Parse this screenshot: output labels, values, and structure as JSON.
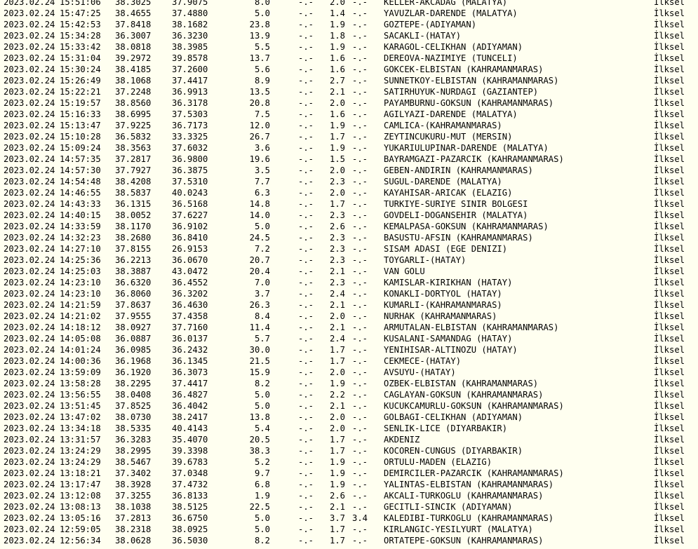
{
  "events": [
    {
      "date": "2023.02.24",
      "time": "15:51:06",
      "lat": "38.3025",
      "lon": "37.9075",
      "depth": "8.0",
      "md": "-.-",
      "ml": "2.0",
      "mw": "-.-",
      "place": "KELLER-AKCADAG (MALATYA)",
      "type": "İlksel"
    },
    {
      "date": "2023.02.24",
      "time": "15:47:25",
      "lat": "38.4655",
      "lon": "37.4880",
      "depth": "5.0",
      "md": "-.-",
      "ml": "1.4",
      "mw": "-.-",
      "place": "YAVUZLAR-DARENDE (MALATYA)",
      "type": "İlksel"
    },
    {
      "date": "2023.02.24",
      "time": "15:42:53",
      "lat": "37.8418",
      "lon": "38.1682",
      "depth": "23.8",
      "md": "-.-",
      "ml": "1.9",
      "mw": "-.-",
      "place": "GOZTEPE-(ADIYAMAN)",
      "type": "İlksel"
    },
    {
      "date": "2023.02.24",
      "time": "15:34:28",
      "lat": "36.3007",
      "lon": "36.3230",
      "depth": "13.9",
      "md": "-.-",
      "ml": "1.8",
      "mw": "-.-",
      "place": "SACAKLI-(HATAY)",
      "type": "İlksel"
    },
    {
      "date": "2023.02.24",
      "time": "15:33:42",
      "lat": "38.0818",
      "lon": "38.3985",
      "depth": "5.5",
      "md": "-.-",
      "ml": "1.9",
      "mw": "-.-",
      "place": "KARAGOL-CELIKHAN (ADIYAMAN)",
      "type": "İlksel"
    },
    {
      "date": "2023.02.24",
      "time": "15:31:04",
      "lat": "39.2972",
      "lon": "39.8578",
      "depth": "13.7",
      "md": "-.-",
      "ml": "1.6",
      "mw": "-.-",
      "place": "DEREOVA-NAZIMIYE (TUNCELI)",
      "type": "İlksel"
    },
    {
      "date": "2023.02.24",
      "time": "15:30:24",
      "lat": "38.4185",
      "lon": "37.2600",
      "depth": "5.6",
      "md": "-.-",
      "ml": "1.6",
      "mw": "-.-",
      "place": "GOKCEK-ELBISTAN (KAHRAMANMARAS)",
      "type": "İlksel"
    },
    {
      "date": "2023.02.24",
      "time": "15:26:49",
      "lat": "38.1068",
      "lon": "37.4417",
      "depth": "8.9",
      "md": "-.-",
      "ml": "2.7",
      "mw": "-.-",
      "place": "SUNNETKOY-ELBISTAN (KAHRAMANMARAS)",
      "type": "İlksel"
    },
    {
      "date": "2023.02.24",
      "time": "15:22:21",
      "lat": "37.2248",
      "lon": "36.9913",
      "depth": "13.5",
      "md": "-.-",
      "ml": "2.1",
      "mw": "-.-",
      "place": "SATIRHUYUK-NURDAGI (GAZIANTEP)",
      "type": "İlksel"
    },
    {
      "date": "2023.02.24",
      "time": "15:19:57",
      "lat": "38.8560",
      "lon": "36.3178",
      "depth": "20.8",
      "md": "-.-",
      "ml": "2.0",
      "mw": "-.-",
      "place": "PAYAMBURNU-GOKSUN (KAHRAMANMARAS)",
      "type": "İlksel"
    },
    {
      "date": "2023.02.24",
      "time": "15:16:33",
      "lat": "38.6995",
      "lon": "37.5303",
      "depth": "7.5",
      "md": "-.-",
      "ml": "1.6",
      "mw": "-.-",
      "place": "AGILYAZI-DARENDE (MALATYA)",
      "type": "İlksel"
    },
    {
      "date": "2023.02.24",
      "time": "15:13:47",
      "lat": "37.9225",
      "lon": "36.7173",
      "depth": "12.0",
      "md": "-.-",
      "ml": "1.9",
      "mw": "-.-",
      "place": "CAMLICA-(KAHRAMANMARAS)",
      "type": "İlksel"
    },
    {
      "date": "2023.02.24",
      "time": "15:10:28",
      "lat": "36.5832",
      "lon": "33.3325",
      "depth": "26.7",
      "md": "-.-",
      "ml": "1.7",
      "mw": "-.-",
      "place": "ZEYTINCUKURU-MUT (MERSIN)",
      "type": "İlksel"
    },
    {
      "date": "2023.02.24",
      "time": "15:09:24",
      "lat": "38.3563",
      "lon": "37.6032",
      "depth": "3.6",
      "md": "-.-",
      "ml": "1.9",
      "mw": "-.-",
      "place": "YUKARIULUPINAR-DARENDE (MALATYA)",
      "type": "İlksel"
    },
    {
      "date": "2023.02.24",
      "time": "14:57:35",
      "lat": "37.2817",
      "lon": "36.9800",
      "depth": "19.6",
      "md": "-.-",
      "ml": "1.5",
      "mw": "-.-",
      "place": "BAYRAMGAZI-PAZARCIK (KAHRAMANMARAS)",
      "type": "İlksel"
    },
    {
      "date": "2023.02.24",
      "time": "14:57:30",
      "lat": "37.7927",
      "lon": "36.3875",
      "depth": "3.5",
      "md": "-.-",
      "ml": "2.0",
      "mw": "-.-",
      "place": "GEBEN-ANDIRIN (KAHRAMANMARAS)",
      "type": "İlksel"
    },
    {
      "date": "2023.02.24",
      "time": "14:54:48",
      "lat": "38.4208",
      "lon": "37.5310",
      "depth": "7.7",
      "md": "-.-",
      "ml": "2.3",
      "mw": "-.-",
      "place": "SUGUL-DARENDE (MALATYA)",
      "type": "İlksel"
    },
    {
      "date": "2023.02.24",
      "time": "14:46:55",
      "lat": "38.5837",
      "lon": "40.0243",
      "depth": "6.3",
      "md": "-.-",
      "ml": "2.0",
      "mw": "-.-",
      "place": "KAYAHISAR-ARICAK (ELAZIG)",
      "type": "İlksel"
    },
    {
      "date": "2023.02.24",
      "time": "14:43:33",
      "lat": "36.1315",
      "lon": "36.5168",
      "depth": "14.8",
      "md": "-.-",
      "ml": "1.7",
      "mw": "-.-",
      "place": "TURKIYE-SURIYE SINIR BOLGESI",
      "type": "İlksel"
    },
    {
      "date": "2023.02.24",
      "time": "14:40:15",
      "lat": "38.0052",
      "lon": "37.6227",
      "depth": "14.0",
      "md": "-.-",
      "ml": "2.3",
      "mw": "-.-",
      "place": "GOVDELI-DOGANSEHIR (MALATYA)",
      "type": "İlksel"
    },
    {
      "date": "2023.02.24",
      "time": "14:33:59",
      "lat": "38.1170",
      "lon": "36.9102",
      "depth": "5.0",
      "md": "-.-",
      "ml": "2.6",
      "mw": "-.-",
      "place": "KEMALPASA-GOKSUN (KAHRAMANMARAS)",
      "type": "İlksel"
    },
    {
      "date": "2023.02.24",
      "time": "14:32:23",
      "lat": "38.2680",
      "lon": "36.8410",
      "depth": "24.5",
      "md": "-.-",
      "ml": "2.3",
      "mw": "-.-",
      "place": "BASUSTU-AFSIN (KAHRAMANMARAS)",
      "type": "İlksel"
    },
    {
      "date": "2023.02.24",
      "time": "14:27:10",
      "lat": "37.8155",
      "lon": "26.9153",
      "depth": "7.2",
      "md": "-.-",
      "ml": "2.3",
      "mw": "-.-",
      "place": "SISAM ADASI (EGE DENIZI)",
      "type": "İlksel"
    },
    {
      "date": "2023.02.24",
      "time": "14:25:36",
      "lat": "36.2213",
      "lon": "36.0670",
      "depth": "20.7",
      "md": "-.-",
      "ml": "2.3",
      "mw": "-.-",
      "place": "TOYGARLI-(HATAY)",
      "type": "İlksel"
    },
    {
      "date": "2023.02.24",
      "time": "14:25:03",
      "lat": "38.3887",
      "lon": "43.0472",
      "depth": "20.4",
      "md": "-.-",
      "ml": "2.1",
      "mw": "-.-",
      "place": "VAN GOLU",
      "type": "İlksel"
    },
    {
      "date": "2023.02.24",
      "time": "14:23:10",
      "lat": "36.6320",
      "lon": "36.4552",
      "depth": "7.0",
      "md": "-.-",
      "ml": "2.3",
      "mw": "-.-",
      "place": "KAMISLAR-KIRIKHAN (HATAY)",
      "type": "İlksel"
    },
    {
      "date": "2023.02.24",
      "time": "14:23:10",
      "lat": "36.8060",
      "lon": "36.3202",
      "depth": "3.7",
      "md": "-.-",
      "ml": "2.4",
      "mw": "-.-",
      "place": "KONAKLI-DORTYOL (HATAY)",
      "type": "İlksel"
    },
    {
      "date": "2023.02.24",
      "time": "14:21:59",
      "lat": "37.8637",
      "lon": "36.4630",
      "depth": "26.3",
      "md": "-.-",
      "ml": "2.1",
      "mw": "-.-",
      "place": "KUMARLI-(KAHRAMANMARAS)",
      "type": "İlksel"
    },
    {
      "date": "2023.02.24",
      "time": "14:21:02",
      "lat": "37.9555",
      "lon": "37.4358",
      "depth": "8.4",
      "md": "-.-",
      "ml": "2.0",
      "mw": "-.-",
      "place": "NURHAK (KAHRAMANMARAS)",
      "type": "İlksel"
    },
    {
      "date": "2023.02.24",
      "time": "14:18:12",
      "lat": "38.0927",
      "lon": "37.7160",
      "depth": "11.4",
      "md": "-.-",
      "ml": "2.1",
      "mw": "-.-",
      "place": "ARMUTALAN-ELBISTAN (KAHRAMANMARAS)",
      "type": "İlksel"
    },
    {
      "date": "2023.02.24",
      "time": "14:05:08",
      "lat": "36.0887",
      "lon": "36.0137",
      "depth": "5.7",
      "md": "-.-",
      "ml": "2.4",
      "mw": "-.-",
      "place": "KUSALANI-SAMANDAG (HATAY)",
      "type": "İlksel"
    },
    {
      "date": "2023.02.24",
      "time": "14:01:24",
      "lat": "36.0985",
      "lon": "36.2432",
      "depth": "30.0",
      "md": "-.-",
      "ml": "1.7",
      "mw": "-.-",
      "place": "YENIHISAR-ALTINOZU (HATAY)",
      "type": "İlksel"
    },
    {
      "date": "2023.02.24",
      "time": "14:00:36",
      "lat": "36.1968",
      "lon": "36.1345",
      "depth": "21.5",
      "md": "-.-",
      "ml": "1.7",
      "mw": "-.-",
      "place": "CEKMECE-(HATAY)",
      "type": "İlksel"
    },
    {
      "date": "2023.02.24",
      "time": "13:59:09",
      "lat": "36.1920",
      "lon": "36.3073",
      "depth": "15.9",
      "md": "-.-",
      "ml": "2.0",
      "mw": "-.-",
      "place": "AVSUYU-(HATAY)",
      "type": "İlksel"
    },
    {
      "date": "2023.02.24",
      "time": "13:58:28",
      "lat": "38.2295",
      "lon": "37.4417",
      "depth": "8.2",
      "md": "-.-",
      "ml": "1.9",
      "mw": "-.-",
      "place": "OZBEK-ELBISTAN (KAHRAMANMARAS)",
      "type": "İlksel"
    },
    {
      "date": "2023.02.24",
      "time": "13:56:55",
      "lat": "38.0408",
      "lon": "36.4827",
      "depth": "5.0",
      "md": "-.-",
      "ml": "2.2",
      "mw": "-.-",
      "place": "CAGLAYAN-GOKSUN (KAHRAMANMARAS)",
      "type": "İlksel"
    },
    {
      "date": "2023.02.24",
      "time": "13:51:45",
      "lat": "37.8525",
      "lon": "36.4042",
      "depth": "5.0",
      "md": "-.-",
      "ml": "2.1",
      "mw": "-.-",
      "place": "KUCUKCAMURLU-GOKSUN (KAHRAMANMARAS)",
      "type": "İlksel"
    },
    {
      "date": "2023.02.24",
      "time": "13:47:02",
      "lat": "38.0730",
      "lon": "38.2417",
      "depth": "13.8",
      "md": "-.-",
      "ml": "2.0",
      "mw": "-.-",
      "place": "GOLBAGI-CELIKHAN (ADIYAMAN)",
      "type": "İlksel"
    },
    {
      "date": "2023.02.24",
      "time": "13:34:18",
      "lat": "38.5335",
      "lon": "40.4143",
      "depth": "5.4",
      "md": "-.-",
      "ml": "2.0",
      "mw": "-.-",
      "place": "SENLIK-LICE (DIYARBAKIR)",
      "type": "İlksel"
    },
    {
      "date": "2023.02.24",
      "time": "13:31:57",
      "lat": "36.3283",
      "lon": "35.4070",
      "depth": "20.5",
      "md": "-.-",
      "ml": "1.7",
      "mw": "-.-",
      "place": "AKDENIZ",
      "type": "İlksel"
    },
    {
      "date": "2023.02.24",
      "time": "13:24:29",
      "lat": "38.2995",
      "lon": "39.3398",
      "depth": "38.3",
      "md": "-.-",
      "ml": "1.7",
      "mw": "-.-",
      "place": "KOCOREN-CUNGUS (DIYARBAKIR)",
      "type": "İlksel"
    },
    {
      "date": "2023.02.24",
      "time": "13:24:29",
      "lat": "38.5467",
      "lon": "39.6783",
      "depth": "5.2",
      "md": "-.-",
      "ml": "1.9",
      "mw": "-.-",
      "place": "ORTULU-MADEN (ELAZIG)",
      "type": "İlksel"
    },
    {
      "date": "2023.02.24",
      "time": "13:18:21",
      "lat": "37.3402",
      "lon": "37.0348",
      "depth": "9.7",
      "md": "-.-",
      "ml": "1.9",
      "mw": "-.-",
      "place": "DEMIRCILER-PAZARCIK (KAHRAMANMARAS)",
      "type": "İlksel"
    },
    {
      "date": "2023.02.24",
      "time": "13:17:47",
      "lat": "38.3928",
      "lon": "37.4732",
      "depth": "6.8",
      "md": "-.-",
      "ml": "1.9",
      "mw": "-.-",
      "place": "YALINTAS-ELBISTAN (KAHRAMANMARAS)",
      "type": "İlksel"
    },
    {
      "date": "2023.02.24",
      "time": "13:12:08",
      "lat": "37.3255",
      "lon": "36.8133",
      "depth": "1.9",
      "md": "-.-",
      "ml": "2.6",
      "mw": "-.-",
      "place": "AKCALI-TURKOGLU (KAHRAMANMARAS)",
      "type": "İlksel"
    },
    {
      "date": "2023.02.24",
      "time": "13:08:13",
      "lat": "38.1038",
      "lon": "38.5125",
      "depth": "22.5",
      "md": "-.-",
      "ml": "2.1",
      "mw": "-.-",
      "place": "GECITLI-SINCIK (ADIYAMAN)",
      "type": "İlksel"
    },
    {
      "date": "2023.02.24",
      "time": "13:05:16",
      "lat": "37.2813",
      "lon": "36.6750",
      "depth": "5.0",
      "md": "-.-",
      "ml": "3.7",
      "mw": "3.4",
      "place": "KALEDIBI-TURKOGLU (KAHRAMANMARAS)",
      "type": "İlksel"
    },
    {
      "date": "2023.02.24",
      "time": "12:59:05",
      "lat": "38.2318",
      "lon": "38.0925",
      "depth": "5.0",
      "md": "-.-",
      "ml": "1.7",
      "mw": "-.-",
      "place": "KIRLANGIC-YESILYURT (MALATYA)",
      "type": "İlksel"
    },
    {
      "date": "2023.02.24",
      "time": "12:56:34",
      "lat": "38.0628",
      "lon": "36.5030",
      "depth": "8.2",
      "md": "-.-",
      "ml": "1.7",
      "mw": "-.-",
      "place": "ORTATEPE-GOKSUN (KAHRAMANMARAS)",
      "type": "İlksel"
    }
  ]
}
